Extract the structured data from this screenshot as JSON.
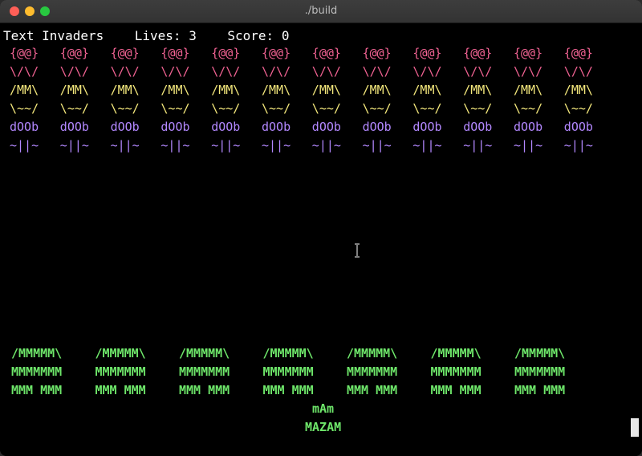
{
  "window": {
    "title": "./build"
  },
  "hud": {
    "game_title": "Text Invaders",
    "lives_label": "Lives:",
    "lives_value": "3",
    "score_label": "Score:",
    "score_value": "0"
  },
  "invaders": {
    "columns": 12,
    "rows": [
      {
        "glyph": "{@@}",
        "color": "#f06292"
      },
      {
        "glyph": "\\/\\/",
        "color": "#f06292"
      },
      {
        "glyph": "/MM\\",
        "color": "#f4e87c"
      },
      {
        "glyph": "\\~~/",
        "color": "#f4e87c"
      },
      {
        "glyph": "dOOb",
        "color": "#b388ff"
      },
      {
        "glyph": "~||~",
        "color": "#b388ff"
      }
    ]
  },
  "bunkers": {
    "count": 7,
    "lines": [
      "/MMMMM\\",
      "MMMMMMM",
      "MMM MMM"
    ],
    "color": "#6ee66a"
  },
  "player": {
    "top": "mAm",
    "bottom": "MAZAM",
    "color": "#6ee66a"
  },
  "icons": {
    "cursor": "ibeam-cursor-icon",
    "terminal_cursor": "block-cursor"
  }
}
